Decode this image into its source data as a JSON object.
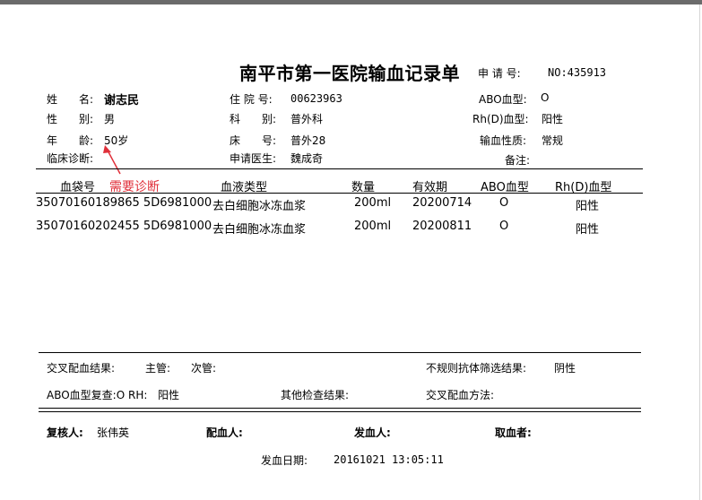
{
  "header": {
    "title": "南平市第一医院输血记录单",
    "app_no_label": "申 请 号:",
    "app_no_value": "NO:435913"
  },
  "patient": {
    "name_label": "姓　　名:",
    "name_value": "谢志民",
    "gender_label": "性　　别:",
    "gender_value": "男",
    "age_label": "年　　龄:",
    "age_value": "50岁",
    "diagnosis_label": "临床诊断:",
    "hospital_no_label": "住 院 号:",
    "hospital_no_value": "00623963",
    "dept_label": "科　　别:",
    "dept_value": "普外科",
    "bed_label": "床　　号:",
    "bed_value": "普外28",
    "doctor_label": "申请医生:",
    "doctor_value": "魏成奇",
    "abo_label": "ABO血型:",
    "abo_value": "O",
    "rh_label": "Rh(D)血型:",
    "rh_value": "阳性",
    "nature_label": "输血性质:",
    "nature_value": "常规",
    "remarks_label": "备注:"
  },
  "annotation": {
    "text": "需要诊断",
    "color": "#e0303a"
  },
  "table": {
    "headers": [
      "血袋号",
      "血液类型",
      "数量",
      "有效期",
      "ABO血型",
      "Rh(D)血型"
    ],
    "rows": [
      [
        "35070160189865 5D6981000",
        "去白细胞冰冻血浆",
        "200ml",
        "20200714",
        "O",
        "阳性"
      ],
      [
        "35070160202455 5D6981000",
        "去白细胞冰冻血浆",
        "200ml",
        "20200811",
        "O",
        "阳性"
      ]
    ]
  },
  "crossmatch": {
    "result_label": "交叉配血结果:",
    "main_label": "主管:",
    "minor_label": "次管:",
    "irregular_label": "不规则抗体筛选结果:",
    "irregular_value": "阴性",
    "recheck_label": "ABO血型复查:O RH:",
    "recheck_value": "阳性",
    "other_label": "其他检查结果:",
    "method_label": "交叉配血方法:"
  },
  "footer": {
    "reviewer_label": "复核人:",
    "reviewer_value": "张伟英",
    "matcher_label": "配血人:",
    "issuer_label": "发血人:",
    "receiver_label": "取血者:",
    "date_label": "发血日期:",
    "date_value": "20161021 13:05:11"
  }
}
